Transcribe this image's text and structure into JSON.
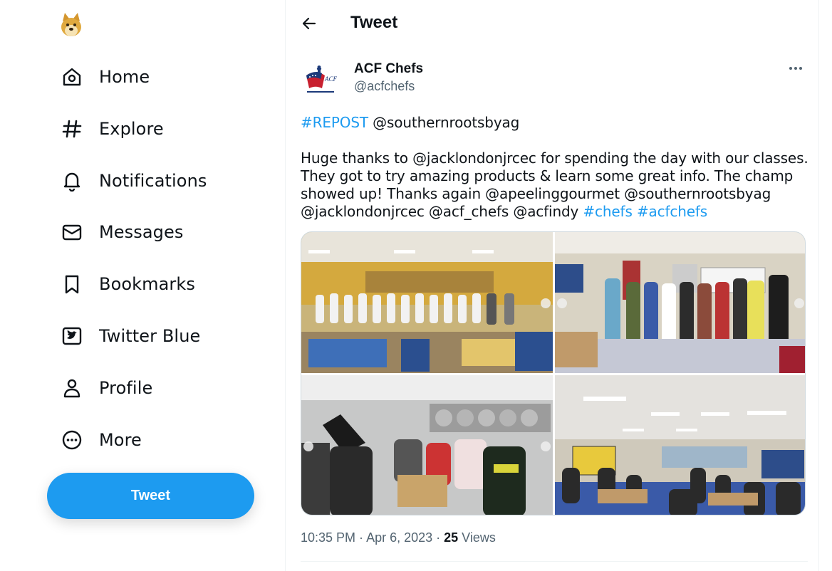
{
  "sidebar": {
    "items": [
      {
        "label": "Home",
        "icon": "home-icon"
      },
      {
        "label": "Explore",
        "icon": "hashtag-icon"
      },
      {
        "label": "Notifications",
        "icon": "bell-icon"
      },
      {
        "label": "Messages",
        "icon": "envelope-icon"
      },
      {
        "label": "Bookmarks",
        "icon": "bookmark-icon"
      },
      {
        "label": "Twitter Blue",
        "icon": "twitter-blue-icon"
      },
      {
        "label": "Profile",
        "icon": "person-icon"
      },
      {
        "label": "More",
        "icon": "more-circle-icon"
      }
    ],
    "tweet_button": "Tweet"
  },
  "header": {
    "title": "Tweet"
  },
  "tweet": {
    "author": {
      "name": "ACF Chefs",
      "handle": "@acfchefs"
    },
    "line1": {
      "hashtag": "#REPOST",
      "mention": " @southernrootsbyag"
    },
    "line2": "Huge thanks to @jacklondonjrcec for spending the day with our classes.",
    "line3": "They got to try amazing products & learn some great info. The champ",
    "line4": "showed up! Thanks again @apeelinggourmet @southernrootsbyag",
    "line5": {
      "text": "@jacklondonjrcec @acf_chefs @acfindy ",
      "tag1": "#chefs",
      "tag2": "#acfchefs"
    },
    "meta": {
      "time": "10:35 PM",
      "sep1": " · ",
      "date": "Apr 6, 2023",
      "sep2": " · ",
      "views_count": "25",
      "views_label": " Views"
    }
  },
  "colors": {
    "accent": "#1d9bf0",
    "text": "#0f1419",
    "muted": "#536471"
  }
}
